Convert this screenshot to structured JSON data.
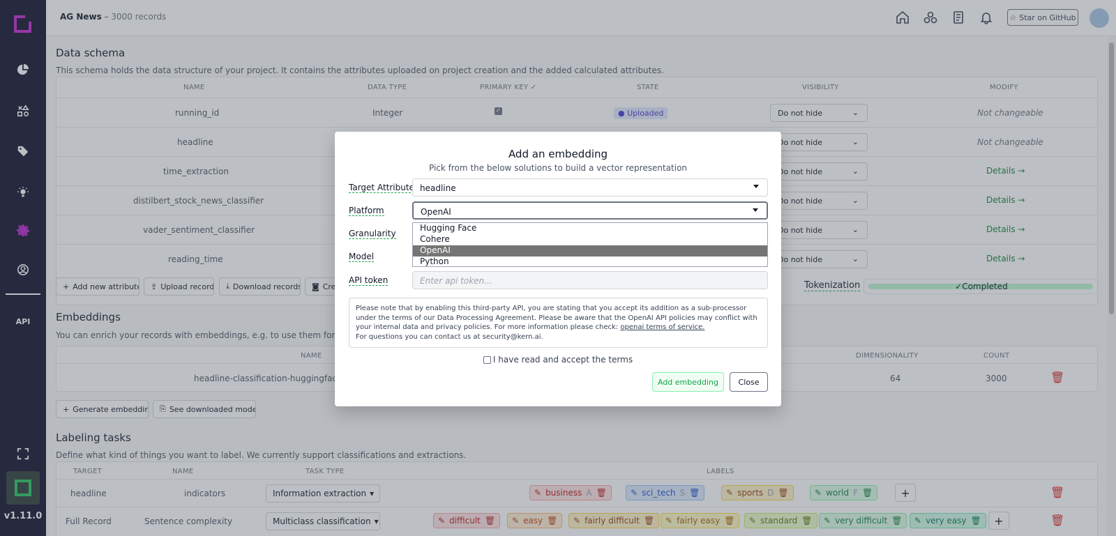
{
  "app": {
    "project_name": "AG News",
    "record_count": "3000 records",
    "version": "v1.11.0",
    "api_label": "API",
    "star_label": "Star on GitHub"
  },
  "schema": {
    "title": "Data schema",
    "description": "This schema holds the data structure of your project. It contains the attributes uploaded on project creation and the added calculated attributes.",
    "headers": {
      "name": "NAME",
      "data_type": "DATA TYPE",
      "primary_key": "PRIMARY KEY",
      "state": "STATE",
      "visibility": "VISIBILITY",
      "modify": "MODIFY"
    },
    "rows": [
      {
        "name": "running_id",
        "data_type": "Integer",
        "state": "Uploaded",
        "visibility": "Do not hide",
        "modify": "Not changeable"
      },
      {
        "name": "headline",
        "visibility": "Do not hide",
        "modify": "Not changeable"
      },
      {
        "name": "time_extraction",
        "visibility": "Do not hide",
        "modify": "Details"
      },
      {
        "name": "distilbert_stock_news_classifier",
        "visibility": "Do not hide",
        "modify": "Details"
      },
      {
        "name": "vader_sentiment_classifier",
        "visibility": "Do not hide",
        "modify": "Details"
      },
      {
        "name": "reading_time",
        "visibility": "Do not hide",
        "modify": "Details"
      }
    ],
    "buttons": {
      "add": "Add new attribute",
      "upload": "Upload records",
      "download": "Download records",
      "create": "Crea"
    },
    "tokenization_label": "Tokenization",
    "tokenization_status": "Completed"
  },
  "embeddings": {
    "title": "Embeddings",
    "description": "You can enrich your records with embeddings, e.g. to use them for vector s",
    "headers": {
      "name": "NAME",
      "dimensionality": "DIMENSIONALITY",
      "count": "COUNT"
    },
    "row": {
      "name": "headline-classification-huggingface-d",
      "dimensionality": "64",
      "count": "3000"
    },
    "buttons": {
      "generate": "Generate embedding",
      "downloaded": "See downloaded models"
    }
  },
  "labeling": {
    "title": "Labeling tasks",
    "description": "Define what kind of things you want to label. We currently support classifications and extractions.",
    "headers": {
      "target": "TARGET",
      "name": "NAME",
      "task_type": "TASK TYPE",
      "labels": "LABELS"
    },
    "rows": [
      {
        "target": "headline",
        "name": "indicators",
        "task_type": "Information extraction",
        "labels": [
          {
            "text": "business",
            "key": "A",
            "color": "#fecaca",
            "fg": "#b91c1c"
          },
          {
            "text": "sci_tech",
            "key": "S",
            "color": "#bfdbfe",
            "fg": "#1d4ed8"
          },
          {
            "text": "sports",
            "key": "D",
            "color": "#fde68a",
            "fg": "#92400e"
          },
          {
            "text": "world",
            "key": "F",
            "color": "#bbf7d0",
            "fg": "#15803d"
          }
        ]
      },
      {
        "target": "Full Record",
        "name": "Sentence complexity",
        "task_type": "Multiclass classification",
        "labels": [
          {
            "text": "difficult",
            "color": "#fecaca",
            "fg": "#b91c1c"
          },
          {
            "text": "easy",
            "color": "#fed7aa",
            "fg": "#c2410c"
          },
          {
            "text": "fairly difficult",
            "color": "#fde68a",
            "fg": "#92400e"
          },
          {
            "text": "fairly easy",
            "color": "#fef08a",
            "fg": "#a16207"
          },
          {
            "text": "standard",
            "color": "#d9f99d",
            "fg": "#4d7c0f"
          },
          {
            "text": "very difficult",
            "color": "#bbf7d0",
            "fg": "#15803d"
          },
          {
            "text": "very easy",
            "color": "#a7f3d0",
            "fg": "#047857"
          }
        ]
      }
    ]
  },
  "modal": {
    "title": "Add an embedding",
    "subtitle": "Pick from the below solutions to build a vector representation",
    "target_label": "Target Attribute",
    "target_value": "headline",
    "platform_label": "Platform",
    "platform_value": "OpenAI",
    "platform_options": [
      "Hugging Face",
      "Cohere",
      "OpenAI",
      "Python"
    ],
    "granularity_label": "Granularity",
    "model_label": "Model",
    "api_token_label": "API token",
    "api_token_placeholder": "Enter api token...",
    "notice_text": "Please note that by enabling this third-party API, you are stating that you accept its addition as a sub-processor under the terms of our Data Processing Agreement. Please be aware that the OpenAI API policies may conflict with your internal data and privacy policies. For more information please check:",
    "notice_link": "openai terms of service.",
    "notice_contact": "For questions you can contact us at security@kern.ai.",
    "terms_label": "I have read and accept the terms",
    "add_button": "Add embedding",
    "close_button": "Close"
  }
}
